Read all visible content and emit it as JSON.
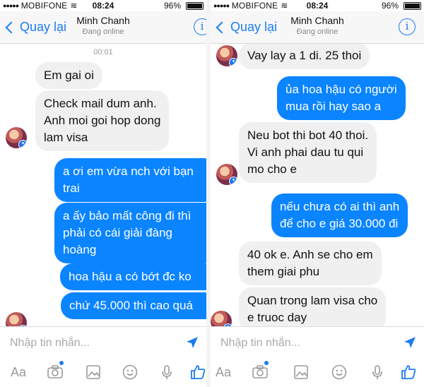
{
  "left": {
    "status": {
      "carrier": "MOBIFONE",
      "time": "08:24",
      "battery": "96%"
    },
    "nav": {
      "back_label": "Quay lại",
      "contact_name": "Minh Chanh",
      "presence": "Đang online"
    },
    "timestamp": "00:01",
    "messages": [
      {
        "dir": "in",
        "text": "Em gai oi"
      },
      {
        "dir": "in",
        "text": "Check mail dum anh.\nAnh moi goi hop dong\nlam visa"
      },
      {
        "dir": "out",
        "text": "a ơi em vừa nch với bạn\ntrai"
      },
      {
        "dir": "out",
        "text": "a ấy bảo mất công đi thì\nphải có cái giải đàng\nhoàng"
      },
      {
        "dir": "out",
        "text": "hoa hậu a có bớt đc ko"
      },
      {
        "dir": "out",
        "text": "chứ 45.000 thì cao quá"
      }
    ],
    "composer": {
      "placeholder": "Nhập tin nhắn...",
      "aa_label": "Aa"
    }
  },
  "right": {
    "status": {
      "carrier": "MOBIFONE",
      "time": "08:24",
      "battery": "96%"
    },
    "nav": {
      "back_label": "Quay lại",
      "contact_name": "Minh Chanh",
      "presence": "Đang online"
    },
    "messages": [
      {
        "dir": "in",
        "text": "Vay lay a 1 di.  25 thoi"
      },
      {
        "dir": "out",
        "text": "ủa hoa hậu có người\nmua rồi hay sao a"
      },
      {
        "dir": "in",
        "text": "Neu bot thi bot 40 thoi.\nVi anh phai dau tu qui\nmo cho e"
      },
      {
        "dir": "out",
        "text": "nếu chưa có ai thì anh\nđể cho e giá 30.000 đi"
      },
      {
        "dir": "in",
        "text": "40 ok e.  Anh se cho em\nthem giai phu"
      },
      {
        "dir": "in",
        "text": "Quan trong lam visa cho\ne truoc day"
      }
    ],
    "composer": {
      "placeholder": "Nhập tin nhắn...",
      "aa_label": "Aa"
    }
  },
  "colors": {
    "accent": "#1b7cf2",
    "outgoing_bubble": "#0a84ff",
    "incoming_bubble": "#f1f0f0"
  },
  "toolbar_icons": [
    "text-format-icon",
    "camera-icon",
    "photo-icon",
    "emoji-icon",
    "microphone-icon",
    "thumbs-up-icon"
  ]
}
